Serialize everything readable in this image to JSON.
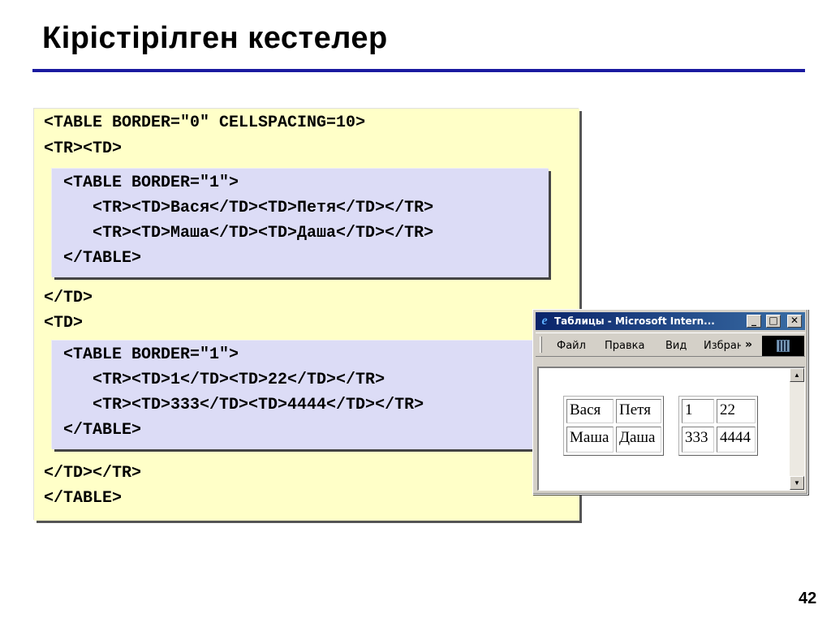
{
  "slide": {
    "title": "Кірістірілген кестелер",
    "page_number": "42"
  },
  "code": {
    "outer_open": "<TABLE BORDER=\"0\" CELLSPACING=10>",
    "tr_td_open": "<TR><TD>",
    "block1": [
      "<TABLE BORDER=\"1\">",
      "   <TR><TD>Вася</TD><TD>Петя</TD></TR>",
      "   <TR><TD>Маша</TD><TD>Даша</TD></TR>",
      "</TABLE>"
    ],
    "td_close": "</TD>",
    "td_open": "<TD>",
    "block2": [
      "<TABLE BORDER=\"1\">",
      "   <TR><TD>1</TD><TD>22</TD></TR>",
      "   <TR><TD>333</TD><TD>4444</TD></TR>",
      "</TABLE>"
    ],
    "td_tr_close": "</TD></TR>",
    "outer_close": "</TABLE>"
  },
  "browser": {
    "window_title": "Таблицы - Microsoft Intern...",
    "buttons": {
      "minimize": "_",
      "maximize": "□",
      "close": "✕"
    },
    "menu": [
      "Файл",
      "Правка",
      "Вид",
      "Избран"
    ],
    "overflow": "»",
    "table1": [
      [
        "Вася",
        "Петя"
      ],
      [
        "Маша",
        "Даша"
      ]
    ],
    "table2": [
      [
        "1",
        "22"
      ],
      [
        "333",
        "4444"
      ]
    ]
  },
  "icons": {
    "browser": "internet-explorer-icon",
    "logo": "windows-logo-icon"
  },
  "colors": {
    "title_rule": "#1a1aa0",
    "code_box": "#ffffc8",
    "inner_box": "#dcdcf6",
    "titlebar_start": "#0a246a",
    "titlebar_end": "#3a6ea5"
  }
}
